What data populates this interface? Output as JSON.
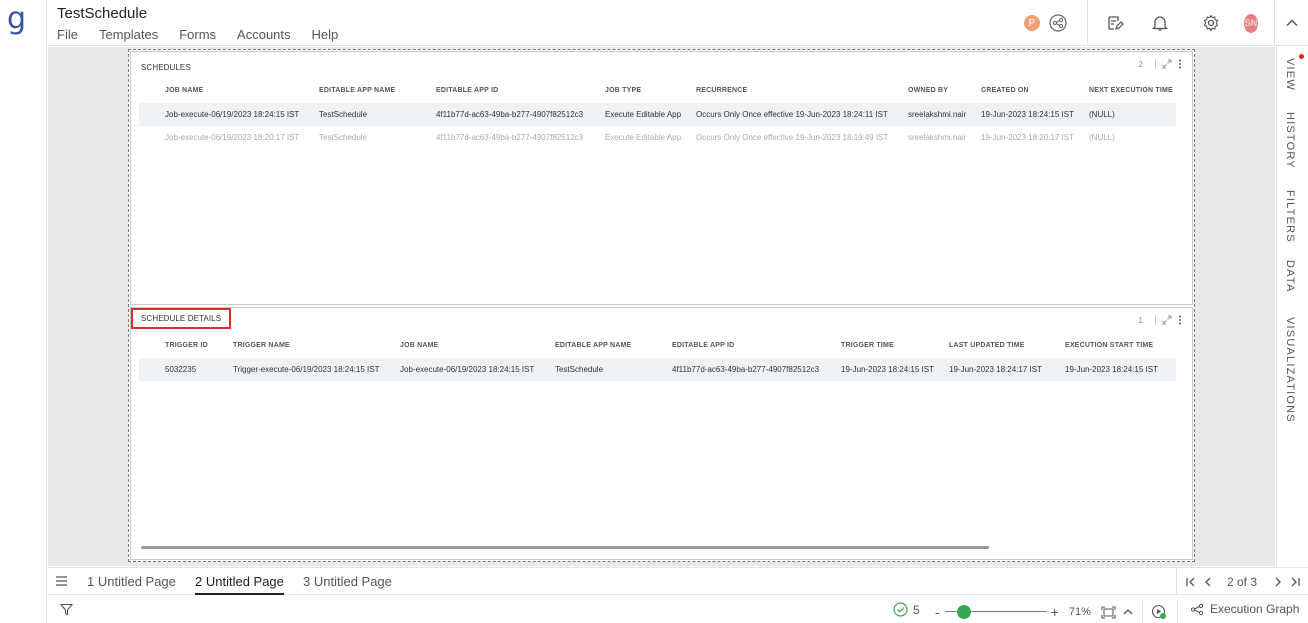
{
  "app": {
    "logo": "g",
    "title": "TestSchedule"
  },
  "menu": [
    "File",
    "Templates",
    "Forms",
    "Accounts",
    "Help"
  ],
  "header_icons": {
    "profile_initial": "P",
    "user_initials": "SN"
  },
  "right_tabs": [
    "VIEW",
    "HISTORY",
    "FILTERS",
    "DATA",
    "VISUALIZATIONS"
  ],
  "schedules": {
    "title": "SCHEDULES",
    "count": "2",
    "columns": [
      "JOB NAME",
      "EDITABLE APP NAME",
      "EDITABLE APP ID",
      "JOB TYPE",
      "RECURRENCE",
      "OWNED BY",
      "CREATED ON",
      "NEXT EXECUTION TIME"
    ],
    "rows": [
      [
        "Job-execute-06/19/2023 18:24:15 IST",
        "TestSchedule",
        "4f11b77d-ac63-49ba-b277-4907f82512c3",
        "Execute Editable App",
        "Occurs Only Once effective 19-Jun-2023 18:24:11 IST",
        "sreelakshmi.nair",
        "19-Jun-2023 18:24:15 IST",
        "(NULL)"
      ],
      [
        "Job-execute-06/19/2023 18:20:17 IST",
        "TestSchedule",
        "4f11b77d-ac63-49ba-b277-4907f82512c3",
        "Execute Editable App",
        "Occurs Only Once effective 19-Jun-2023 18:19:49 IST",
        "sreelakshmi.nair",
        "19-Jun-2023 18:20:17 IST",
        "(NULL)"
      ]
    ]
  },
  "schedule_details": {
    "title": "SCHEDULE DETAILS",
    "count": "1",
    "columns": [
      "TRIGGER ID",
      "TRIGGER NAME",
      "JOB NAME",
      "EDITABLE APP NAME",
      "EDITABLE APP ID",
      "TRIGGER TIME",
      "LAST UPDATED TIME",
      "EXECUTION START TIME"
    ],
    "rows": [
      [
        "5032235",
        "Trigger-execute-06/19/2023 18:24:15 IST",
        "Job-execute-06/19/2023 18:24:15 IST",
        "TestSchedule",
        "4f11b77d-ac63-49ba-b277-4907f82512c3",
        "19-Jun-2023 18:24:15 IST",
        "19-Jun-2023 18:24:17 IST",
        "19-Jun-2023 18:24:15 IST"
      ]
    ]
  },
  "pages": [
    "1 Untitled Page",
    "2 Untitled Page",
    "3 Untitled Page"
  ],
  "active_page_index": 1,
  "page_indicator": "2 of 3",
  "status": {
    "check_count": "5",
    "zoom": "71%",
    "zoom_level": 0.71,
    "execution_graph": "Execution Graph"
  },
  "colors": {
    "accent": "#3a54a4",
    "highlight": "#d32f2f",
    "ok": "#3aa655"
  }
}
